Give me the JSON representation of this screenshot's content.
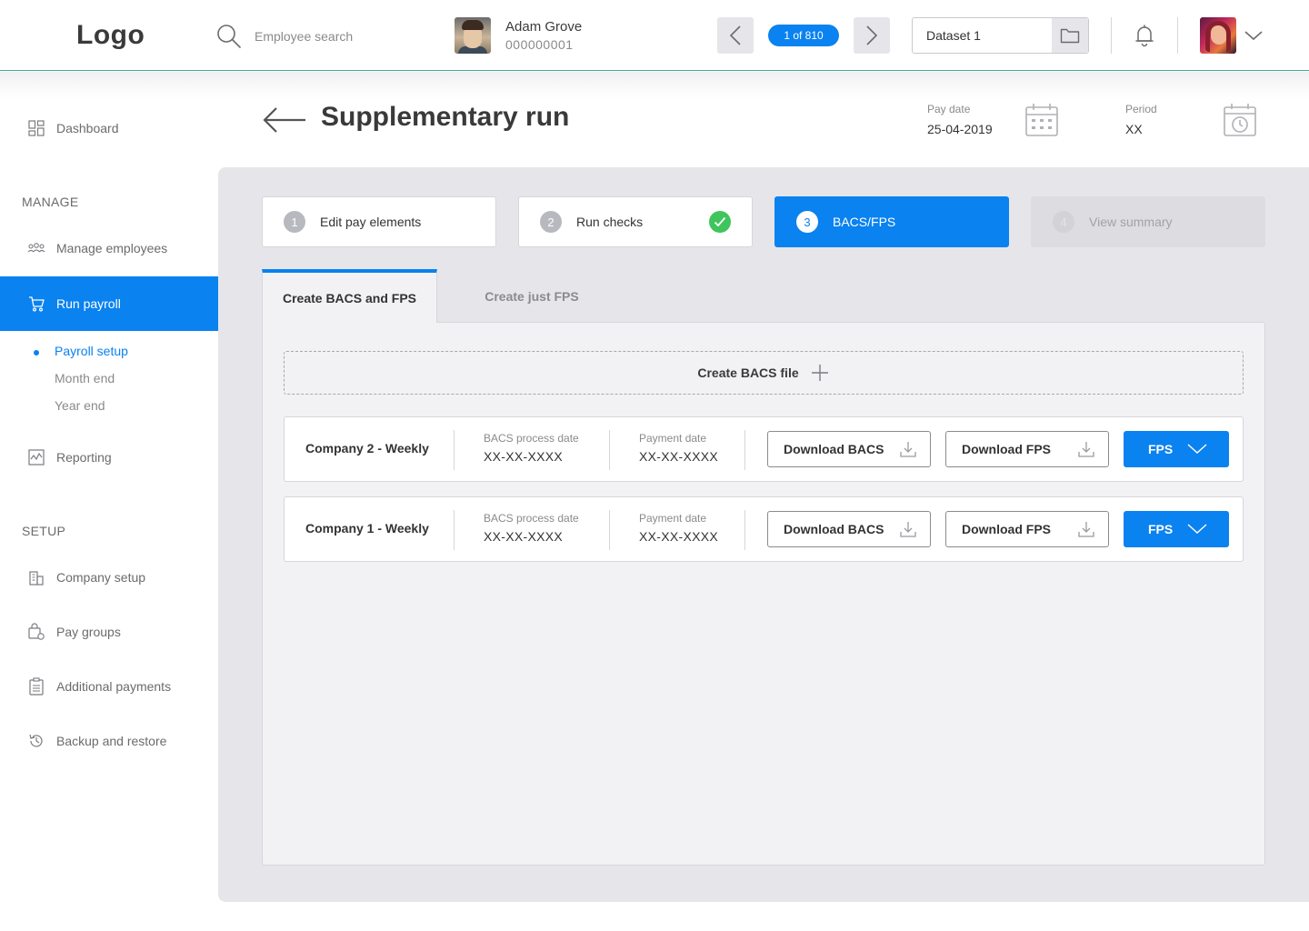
{
  "header": {
    "logo": "Logo",
    "search_placeholder": "Employee search",
    "employee": {
      "name": "Adam Grove",
      "id": "000000001"
    },
    "counter": "1 of 810",
    "dataset": "Dataset 1"
  },
  "sidebar": {
    "dashboard": "Dashboard",
    "manage_heading": "MANAGE",
    "manage_employees": "Manage employees",
    "run_payroll": "Run payroll",
    "sub_items": [
      "Payroll setup",
      "Month end",
      "Year end"
    ],
    "reporting": "Reporting",
    "setup_heading": "SETUP",
    "company_setup": "Company setup",
    "pay_groups": "Pay groups",
    "additional_payments": "Additional payments",
    "backup_restore": "Backup and restore"
  },
  "page": {
    "title": "Supplementary run",
    "pay_date_label": "Pay date",
    "pay_date_value": "25-04-2019",
    "period_label": "Period",
    "period_value": "XX"
  },
  "steps": [
    {
      "num": "1",
      "label": "Edit pay elements",
      "state": "default"
    },
    {
      "num": "2",
      "label": "Run checks",
      "state": "done"
    },
    {
      "num": "3",
      "label": "BACS/FPS",
      "state": "active"
    },
    {
      "num": "4",
      "label": "View summary",
      "state": "disabled"
    }
  ],
  "tabs": {
    "active": "Create BACS and FPS",
    "inactive": "Create just FPS"
  },
  "create_bacs_label": "Create BACS file",
  "companies": [
    {
      "name": "Company 2 - Weekly",
      "bacs_label": "BACS process date",
      "bacs_value": "XX-XX-XXXX",
      "pay_label": "Payment date",
      "pay_value": "XX-XX-XXXX",
      "download_bacs": "Download BACS",
      "download_fps": "Download FPS",
      "fps": "FPS"
    },
    {
      "name": "Company 1 - Weekly",
      "bacs_label": "BACS process date",
      "bacs_value": "XX-XX-XXXX",
      "pay_label": "Payment date",
      "pay_value": "XX-XX-XXXX",
      "download_bacs": "Download BACS",
      "download_fps": "Download FPS",
      "fps": "FPS"
    }
  ],
  "colors": {
    "primary": "#0a82f0",
    "success": "#3ec55b",
    "panel": "#e6e6ea",
    "header_rule": "#3fae8c"
  }
}
